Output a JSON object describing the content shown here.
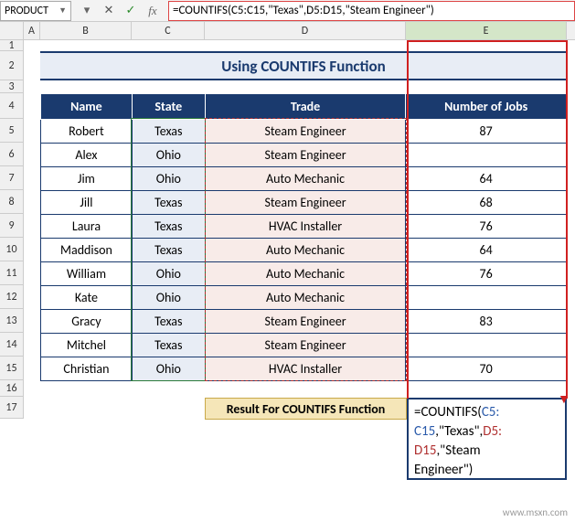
{
  "formula_bar": {
    "name_box": "PRODUCT",
    "formula": "=COUNTIFS(C5:C15,\"Texas\",D5:D15,\"Steam Engineer\")"
  },
  "columns": [
    "A",
    "B",
    "C",
    "D",
    "E"
  ],
  "rows": [
    "1",
    "2",
    "3",
    "4",
    "5",
    "6",
    "7",
    "8",
    "9",
    "10",
    "11",
    "12",
    "13",
    "14",
    "15",
    "16",
    "17"
  ],
  "title": "Using COUNTIFS Function",
  "headers": {
    "name": "Name",
    "state": "State",
    "trade": "Trade",
    "num": "Number of Jobs"
  },
  "data": [
    {
      "name": "Robert",
      "state": "Texas",
      "trade": "Steam Engineer",
      "num": "87"
    },
    {
      "name": "Alex",
      "state": "Ohio",
      "trade": "Steam Engineer",
      "num": ""
    },
    {
      "name": "Jim",
      "state": "Ohio",
      "trade": "Auto Mechanic",
      "num": "64"
    },
    {
      "name": "Jill",
      "state": "Texas",
      "trade": "Steam Engineer",
      "num": "68"
    },
    {
      "name": "Laura",
      "state": "Texas",
      "trade": "HVAC Installer",
      "num": "76"
    },
    {
      "name": "Maddison",
      "state": "Texas",
      "trade": "Auto Mechanic",
      "num": "64"
    },
    {
      "name": "William",
      "state": "Ohio",
      "trade": "Auto Mechanic",
      "num": "76"
    },
    {
      "name": "Kate",
      "state": "Ohio",
      "trade": "Auto Mechanic",
      "num": ""
    },
    {
      "name": "Gracy",
      "state": "Texas",
      "trade": "Steam Engineer",
      "num": "83"
    },
    {
      "name": "Mitchel",
      "state": "Texas",
      "trade": "Steam Engineer",
      "num": ""
    },
    {
      "name": "Christian",
      "state": "Ohio",
      "trade": "HVAC Installer",
      "num": "70"
    }
  ],
  "result_label": "Result For COUNTIFS Function",
  "editing_formula": {
    "parts": [
      {
        "cls": "eq",
        "t": "="
      },
      {
        "cls": "func",
        "t": "COUNTIFS("
      },
      {
        "cls": "ref-c",
        "t": "C5:"
      },
      {
        "cls": "ref-c",
        "t": "C15"
      },
      {
        "cls": "lit",
        "t": ",\"Texas\","
      },
      {
        "cls": "ref-d",
        "t": "D5:"
      },
      {
        "cls": "ref-d",
        "t": "D15"
      },
      {
        "cls": "lit",
        "t": ",\"Steam"
      },
      {
        "cls": "lit",
        "t": " Engineer\")"
      }
    ]
  },
  "watermark": "www.msxn.com"
}
